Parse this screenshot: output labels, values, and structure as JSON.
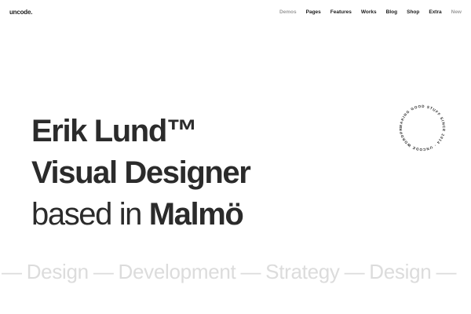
{
  "header": {
    "logo": "uncode.",
    "nav": [
      {
        "label": "Demos",
        "muted": true
      },
      {
        "label": "Pages",
        "muted": false
      },
      {
        "label": "Features",
        "muted": false
      },
      {
        "label": "Works",
        "muted": false
      },
      {
        "label": "Blog",
        "muted": false
      },
      {
        "label": "Shop",
        "muted": false
      },
      {
        "label": "Extra",
        "muted": false
      },
      {
        "label": "New",
        "muted": true
      }
    ]
  },
  "hero": {
    "name": "Erik Lund™",
    "role": "Visual Designer",
    "location_prefix": "based in",
    "location": "Malmö"
  },
  "badge": {
    "circular_text": "MAKING GOOD STUFF SINCE 2014 · UNCODE WORDPRESS THEME ·"
  },
  "marquee": {
    "items": [
      "",
      "Design",
      "Development",
      "Strategy",
      "Design"
    ]
  },
  "colors": {
    "text": "#2b2b2b",
    "muted_nav": "#9b9b9b",
    "marquee": "#dcdcdc",
    "background": "#ffffff"
  }
}
